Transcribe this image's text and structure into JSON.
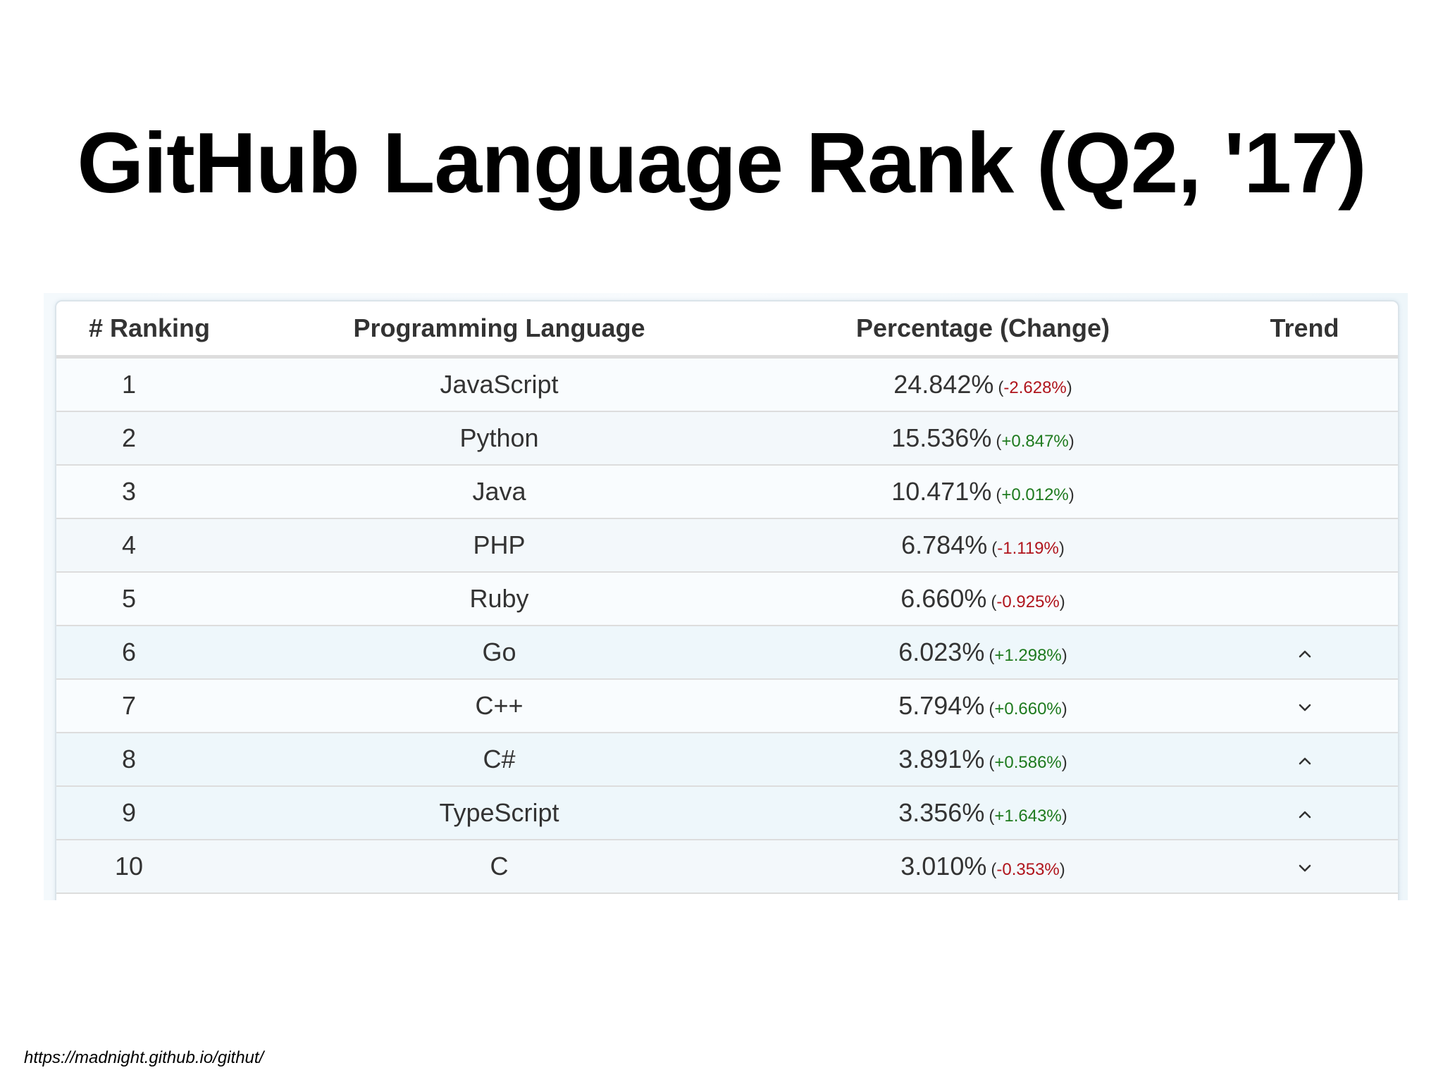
{
  "title": "GitHub Language Rank (Q2, '17)",
  "table": {
    "headers": {
      "ranking": "# Ranking",
      "language": "Programming Language",
      "percentage": "Percentage (Change)",
      "trend": "Trend"
    },
    "rows": [
      {
        "rank": "1",
        "language": "JavaScript",
        "percent": "24.842%",
        "change_open": "(",
        "change": "-2.628%",
        "change_close": ")",
        "change_sign": "negative",
        "trend": ""
      },
      {
        "rank": "2",
        "language": "Python",
        "percent": "15.536%",
        "change_open": "(",
        "change": "+0.847%",
        "change_close": ")",
        "change_sign": "positive",
        "trend": ""
      },
      {
        "rank": "3",
        "language": "Java",
        "percent": "10.471%",
        "change_open": "(",
        "change": "+0.012%",
        "change_close": ")",
        "change_sign": "positive",
        "trend": ""
      },
      {
        "rank": "4",
        "language": "PHP",
        "percent": "6.784%",
        "change_open": "(",
        "change": "-1.119%",
        "change_close": ")",
        "change_sign": "negative",
        "trend": ""
      },
      {
        "rank": "5",
        "language": "Ruby",
        "percent": "6.660%",
        "change_open": "(",
        "change": "-0.925%",
        "change_close": ")",
        "change_sign": "negative",
        "trend": ""
      },
      {
        "rank": "6",
        "language": "Go",
        "percent": "6.023%",
        "change_open": "(",
        "change": "+1.298%",
        "change_close": ")",
        "change_sign": "positive",
        "trend": "up"
      },
      {
        "rank": "7",
        "language": "C++",
        "percent": "5.794%",
        "change_open": "(",
        "change": "+0.660%",
        "change_close": ")",
        "change_sign": "positive",
        "trend": "down"
      },
      {
        "rank": "8",
        "language": "C#",
        "percent": "3.891%",
        "change_open": "(",
        "change": "+0.586%",
        "change_close": ")",
        "change_sign": "positive",
        "trend": "up"
      },
      {
        "rank": "9",
        "language": "TypeScript",
        "percent": "3.356%",
        "change_open": "(",
        "change": "+1.643%",
        "change_close": ")",
        "change_sign": "positive",
        "trend": "up"
      },
      {
        "rank": "10",
        "language": "C",
        "percent": "3.010%",
        "change_open": "(",
        "change": "-0.353%",
        "change_close": ")",
        "change_sign": "negative",
        "trend": "down"
      }
    ]
  },
  "source": "https://madnight.github.io/githut/",
  "colors": {
    "negative": "#b0141c",
    "positive": "#1e7a1e",
    "text": "#333333"
  },
  "icons": {
    "up": "chevron-up-icon",
    "down": "chevron-down-icon"
  }
}
